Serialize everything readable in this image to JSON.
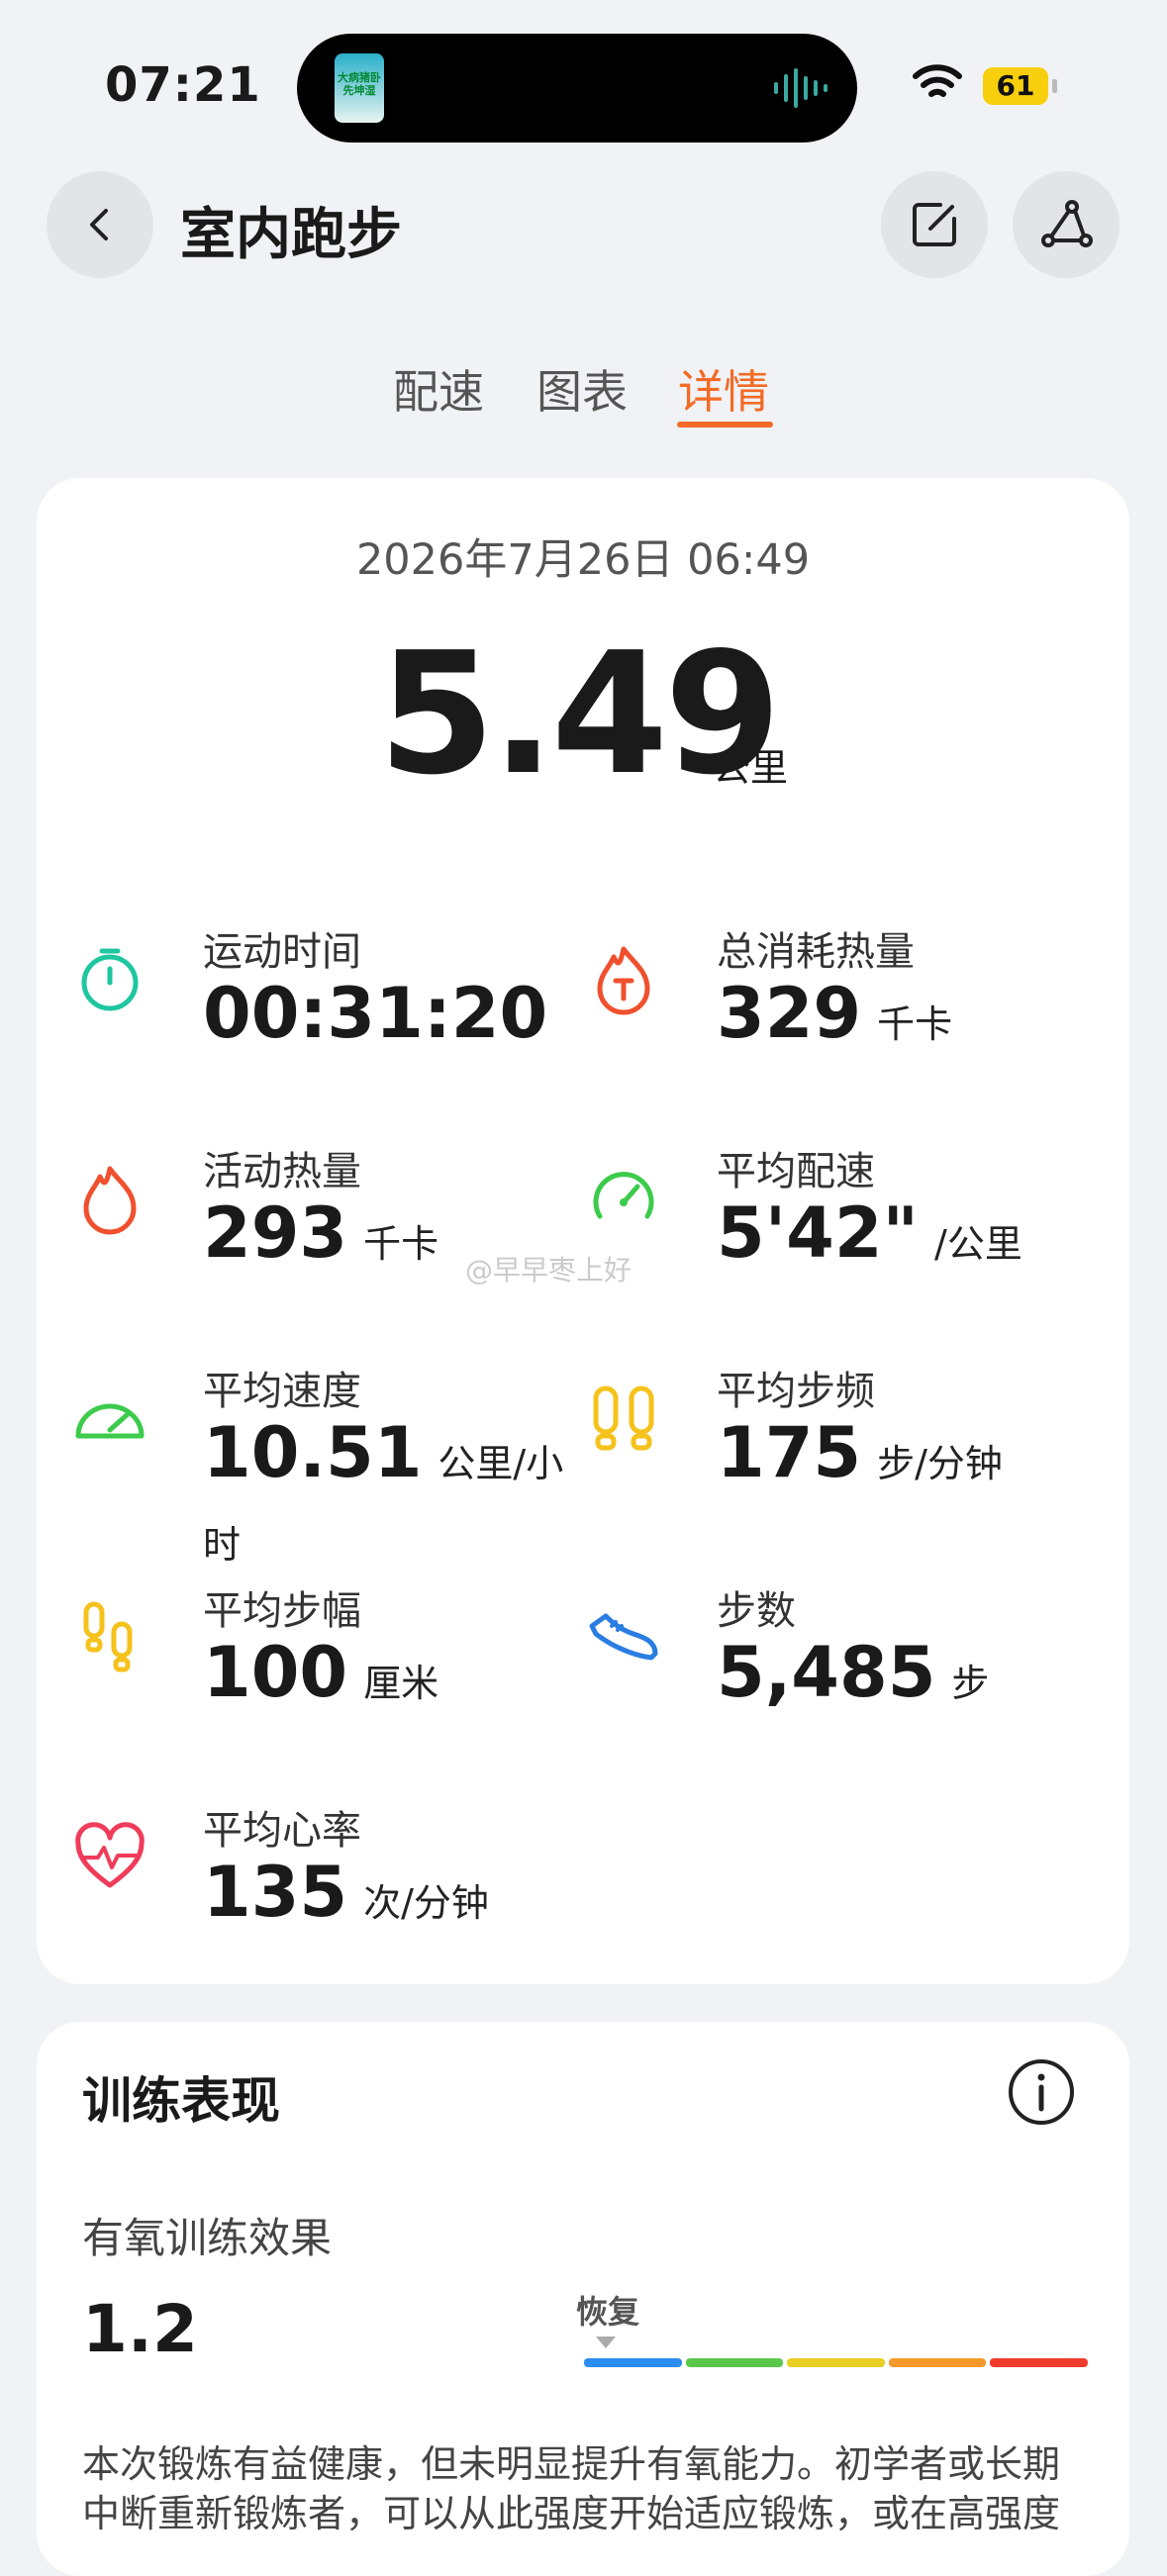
{
  "status_bar": {
    "time": "07:21",
    "battery": "61",
    "island_thumb_text": "大病猪卧先坤湿"
  },
  "header": {
    "title": "室内跑步"
  },
  "tabs": [
    {
      "label": "配速",
      "active": false
    },
    {
      "label": "图表",
      "active": false
    },
    {
      "label": "详情",
      "active": true
    }
  ],
  "summary": {
    "datetime": "2026年7月26日 06:49",
    "distance": "5.49",
    "distance_unit": "公里"
  },
  "metrics": [
    {
      "label": "运动时间",
      "value": "00:31:20",
      "unit": "",
      "icon": "stopwatch-icon",
      "color": "#1fc6a0"
    },
    {
      "label": "总消耗热量",
      "value": "329",
      "unit": "千卡",
      "icon": "total-calorie-icon",
      "color": "#f0502e"
    },
    {
      "label": "活动热量",
      "value": "293",
      "unit": "千卡",
      "icon": "flame-icon",
      "color": "#f0502e"
    },
    {
      "label": "平均配速",
      "value": "5'42\"",
      "unit": "/公里",
      "icon": "pace-gauge-icon",
      "color": "#3ccb4a"
    },
    {
      "label": "平均速度",
      "value": "10.51",
      "unit": "公里/小时",
      "icon": "speedometer-icon",
      "color": "#3ccb4a"
    },
    {
      "label": "平均步频",
      "value": "175",
      "unit": "步/分钟",
      "icon": "footprints-icon",
      "color": "#f5c21b"
    },
    {
      "label": "平均步幅",
      "value": "100",
      "unit": "厘米",
      "icon": "stride-icon",
      "color": "#f5c21b"
    },
    {
      "label": "步数",
      "value": "5,485",
      "unit": "步",
      "icon": "shoe-icon",
      "color": "#2a7de1"
    },
    {
      "label": "平均心率",
      "value": "135",
      "unit": "次/分钟",
      "icon": "heart-rate-icon",
      "color": "#f03c5a"
    }
  ],
  "watermark": "@早早枣上好",
  "performance": {
    "title": "训练表现",
    "aerobic_label": "有氧训练效果",
    "aerobic_value": "1.2",
    "level_label": "恢复",
    "level_colors": [
      "#2b8df0",
      "#59c84a",
      "#e8cf22",
      "#f59a2a",
      "#ef3b2c"
    ],
    "description": "本次锻炼有益健康，但未明显提升有氧能力。初学者或长期中断重新锻炼者，可以从此强度开始适应锻炼，或在高强度"
  }
}
